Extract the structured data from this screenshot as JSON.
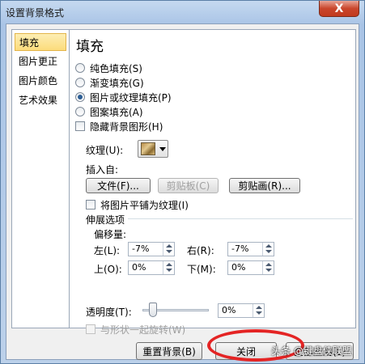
{
  "window": {
    "title": "设置背景格式",
    "close_glyph": "X"
  },
  "nav": {
    "items": [
      {
        "label": "填充",
        "selected": true
      },
      {
        "label": "图片更正",
        "selected": false
      },
      {
        "label": "图片颜色",
        "selected": false
      },
      {
        "label": "艺术效果",
        "selected": false
      }
    ]
  },
  "panel": {
    "title": "填充",
    "options": [
      {
        "label": "纯色填充(S)",
        "checked": false
      },
      {
        "label": "渐变填充(G)",
        "checked": false
      },
      {
        "label": "图片或纹理填充(P)",
        "checked": true
      },
      {
        "label": "图案填充(A)",
        "checked": false
      }
    ],
    "hide_bg_label": "隐藏背景图形(H)",
    "texture_label": "纹理(U):",
    "insert_from_label": "插入自:",
    "file_btn": "文件(F)...",
    "clipboard_btn": "剪贴板(C)",
    "clipart_btn": "剪贴画(R)...",
    "tile_label": "将图片平铺为纹理(I)",
    "stretch_label": "伸展选项",
    "offset_label": "偏移量:",
    "left_label": "左(L):",
    "left_value": "-7%",
    "right_label": "右(R):",
    "right_value": "-7%",
    "top_label": "上(O):",
    "top_value": "0%",
    "bottom_label": "下(M):",
    "bottom_value": "0%",
    "transparency_label": "透明度(T):",
    "transparency_value": "0%",
    "rotate_label": "与形状一起旋转(W)"
  },
  "footer": {
    "reset_btn": "重置背景(B)",
    "close_btn": "关闭",
    "apply_all_btn": "全部应用(L)"
  },
  "watermark": "头条 @键盘侠联盟",
  "colors": {
    "selected_nav": "#fbdc7c",
    "highlight": "#e42424"
  }
}
